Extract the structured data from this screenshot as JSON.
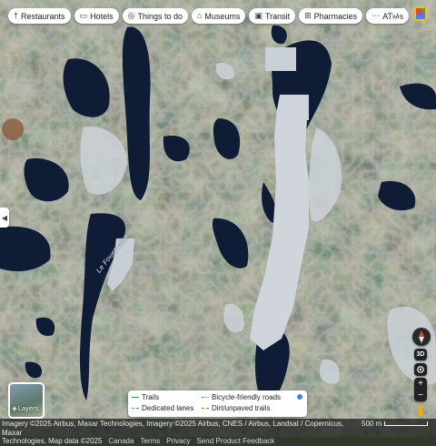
{
  "chips": [
    {
      "icon": "fork-knife-icon",
      "glyph": "†",
      "label": "Restaurants"
    },
    {
      "icon": "bed-icon",
      "glyph": "▭",
      "label": "Hotels"
    },
    {
      "icon": "camera-icon",
      "glyph": "◎",
      "label": "Things to do"
    },
    {
      "icon": "museum-icon",
      "glyph": "⌂",
      "label": "Museums"
    },
    {
      "icon": "bus-icon",
      "glyph": "▣",
      "label": "Transit"
    },
    {
      "icon": "pharmacy-icon",
      "glyph": "⊞",
      "label": "Pharmacies"
    },
    {
      "icon": "atm-icon",
      "glyph": "⋯",
      "label": "ATMs"
    }
  ],
  "map": {
    "lake_label": "Le Fouet Lake"
  },
  "controls": {
    "three_d": "3D",
    "zoom_in": "+",
    "zoom_out": "−"
  },
  "layers": {
    "label": "Layers"
  },
  "legend": {
    "trails": "Trails",
    "dedicated_lanes": "Dedicated lanes",
    "bicycle_friendly_roads": "Bicycle-friendly roads",
    "dirt_unpaved_trails": "Dirt/unpaved trails",
    "colors": {
      "trail": "#34a853",
      "dirt": "#9b7b3e",
      "dot": "#4a7ef0"
    }
  },
  "footer": {
    "imagery_line1": "Imagery ©2025 Airbus, Maxar Technologies, Imagery ©2025 Airbus, CNES / Airbus, Landsat / Copernicus, Maxar",
    "imagery_line2": "Technologies, Map data ©2025",
    "links": [
      "Canada",
      "Terms",
      "Privacy",
      "Send Product Feedback"
    ],
    "scale": "500 m"
  }
}
